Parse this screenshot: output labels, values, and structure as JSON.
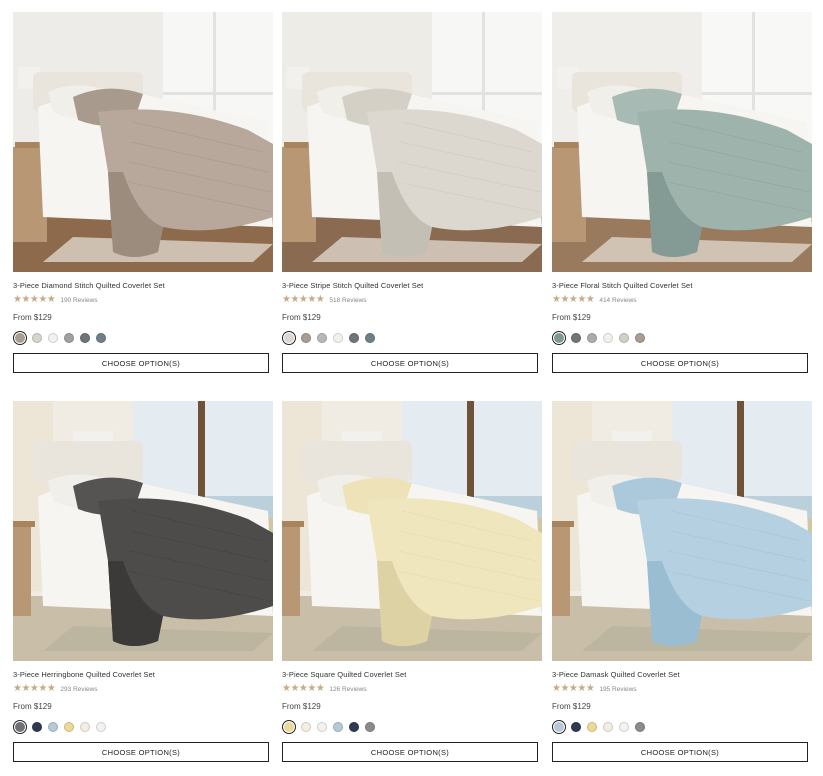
{
  "products": [
    {
      "title": "3-Piece Diamond Stitch Quilted Coverlet Set",
      "stars": "★★★★★",
      "reviews": "190 Reviews",
      "price": "From $129",
      "button": "CHOOSE OPTION(S)",
      "colors": {
        "quilt": "#b7a89b",
        "quiltShade": "#9c8c7e",
        "wall": "#eeece8",
        "floor": "#8e6a4c",
        "pillow": "#a89a8c",
        "window": "#f7f7f6"
      },
      "swatches": [
        "#a99c90",
        "#d6d4cc",
        "#f2f1ee",
        "#9fa1a0",
        "#6e7478",
        "#6d7f88"
      ]
    },
    {
      "title": "3-Piece Stripe Stitch Quilted Coverlet Set",
      "stars": "★★★★★",
      "reviews": "518 Reviews",
      "price": "From $129",
      "button": "CHOOSE OPTION(S)",
      "colors": {
        "quilt": "#dcd8cf",
        "quiltShade": "#c4bfb4",
        "wall": "#eeece7",
        "floor": "#8a6a50",
        "pillow": "#d5d0c5",
        "window": "#f7f7f5"
      },
      "swatches": [
        "#d9d8d4",
        "#a99c90",
        "#b8b9b6",
        "#f1f1ee",
        "#6e7478",
        "#6d7f88"
      ]
    },
    {
      "title": "3-Piece Floral Stitch Quilted Coverlet Set",
      "stars": "★★★★★",
      "reviews": "414 Reviews",
      "price": "From $129",
      "button": "CHOOSE OPTION(S)",
      "colors": {
        "quilt": "#9fb3ad",
        "quiltShade": "#849a94",
        "wall": "#efeeea",
        "floor": "#9a7a5c",
        "pillow": "#a7bab4",
        "window": "#f8f8f7"
      },
      "swatches": [
        "#7f9a8f",
        "#6e7478",
        "#a9acab",
        "#f1f1ee",
        "#cfd1c6",
        "#a99c90"
      ]
    },
    {
      "title": "3-Piece Herringbone Quilted Coverlet Set",
      "stars": "★★★★★",
      "reviews": "293 Reviews",
      "price": "From $129",
      "button": "CHOOSE OPTION(S)",
      "colors": {
        "quilt": "#4d4c4b",
        "quiltShade": "#3b3a39",
        "wall": "#f1ece3",
        "floor": "#c9bfa8",
        "pillow": "#555453",
        "window": "#d9d7c5"
      },
      "swatches": [
        "#707175",
        "#2f3a52",
        "#b5c9d8",
        "#ecd998",
        "#f3ede2",
        "#f3f2f0"
      ]
    },
    {
      "title": "3-Piece Square Quilted Coverlet Set",
      "stars": "★★★★★",
      "reviews": "126 Reviews",
      "price": "From $129",
      "button": "CHOOSE OPTION(S)",
      "colors": {
        "quilt": "#efe6bd",
        "quiltShade": "#ddd2a4",
        "wall": "#f1ece3",
        "floor": "#c9bfa8",
        "pillow": "#eee3b8",
        "window": "#d9d7c5"
      },
      "swatches": [
        "#ecd998",
        "#f3ede2",
        "#f3f2f0",
        "#b5c9d8",
        "#2f3a52",
        "#8a8b8d"
      ]
    },
    {
      "title": "3-Piece Damask Quilted Coverlet Set",
      "stars": "★★★★★",
      "reviews": "195 Reviews",
      "price": "From $129",
      "button": "CHOOSE OPTION(S)",
      "colors": {
        "quilt": "#b4d0e1",
        "quiltShade": "#9bbdd2",
        "wall": "#f1ece3",
        "floor": "#c9bfa8",
        "pillow": "#acc9db",
        "window": "#d9d7c5"
      },
      "swatches": [
        "#b5c9d8",
        "#2f3a52",
        "#ecd998",
        "#f3ede2",
        "#f3f2f0",
        "#8a8b8d"
      ]
    }
  ]
}
